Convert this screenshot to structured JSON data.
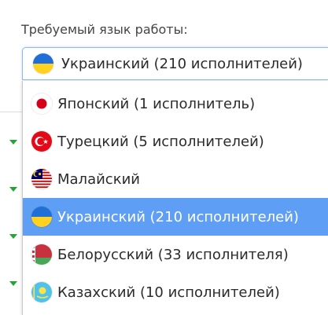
{
  "field_label": "Требуемый язык работы:",
  "selected": {
    "label": "Украинский (210 исполнителей)",
    "flag": "ukraine-flag-icon"
  },
  "options": [
    {
      "label": "Японский (1 исполнитель)",
      "flag": "japan-flag-icon"
    },
    {
      "label": "Турецкий (5 исполнителей)",
      "flag": "turkey-flag-icon"
    },
    {
      "label": "Малайский",
      "flag": "malaysia-flag-icon"
    },
    {
      "label": "Украинский (210 исполнителей)",
      "flag": "ukraine-flag-icon",
      "selected": true
    },
    {
      "label": "Белорусский (33 исполнителя)",
      "flag": "belarus-flag-icon"
    },
    {
      "label": "Казахский (10 исполнителей)",
      "flag": "kazakhstan-flag-icon"
    }
  ],
  "colors": {
    "highlight": "#5f9ef5",
    "border_focus": "#8fb7f0",
    "arrow": "#27a13a"
  }
}
